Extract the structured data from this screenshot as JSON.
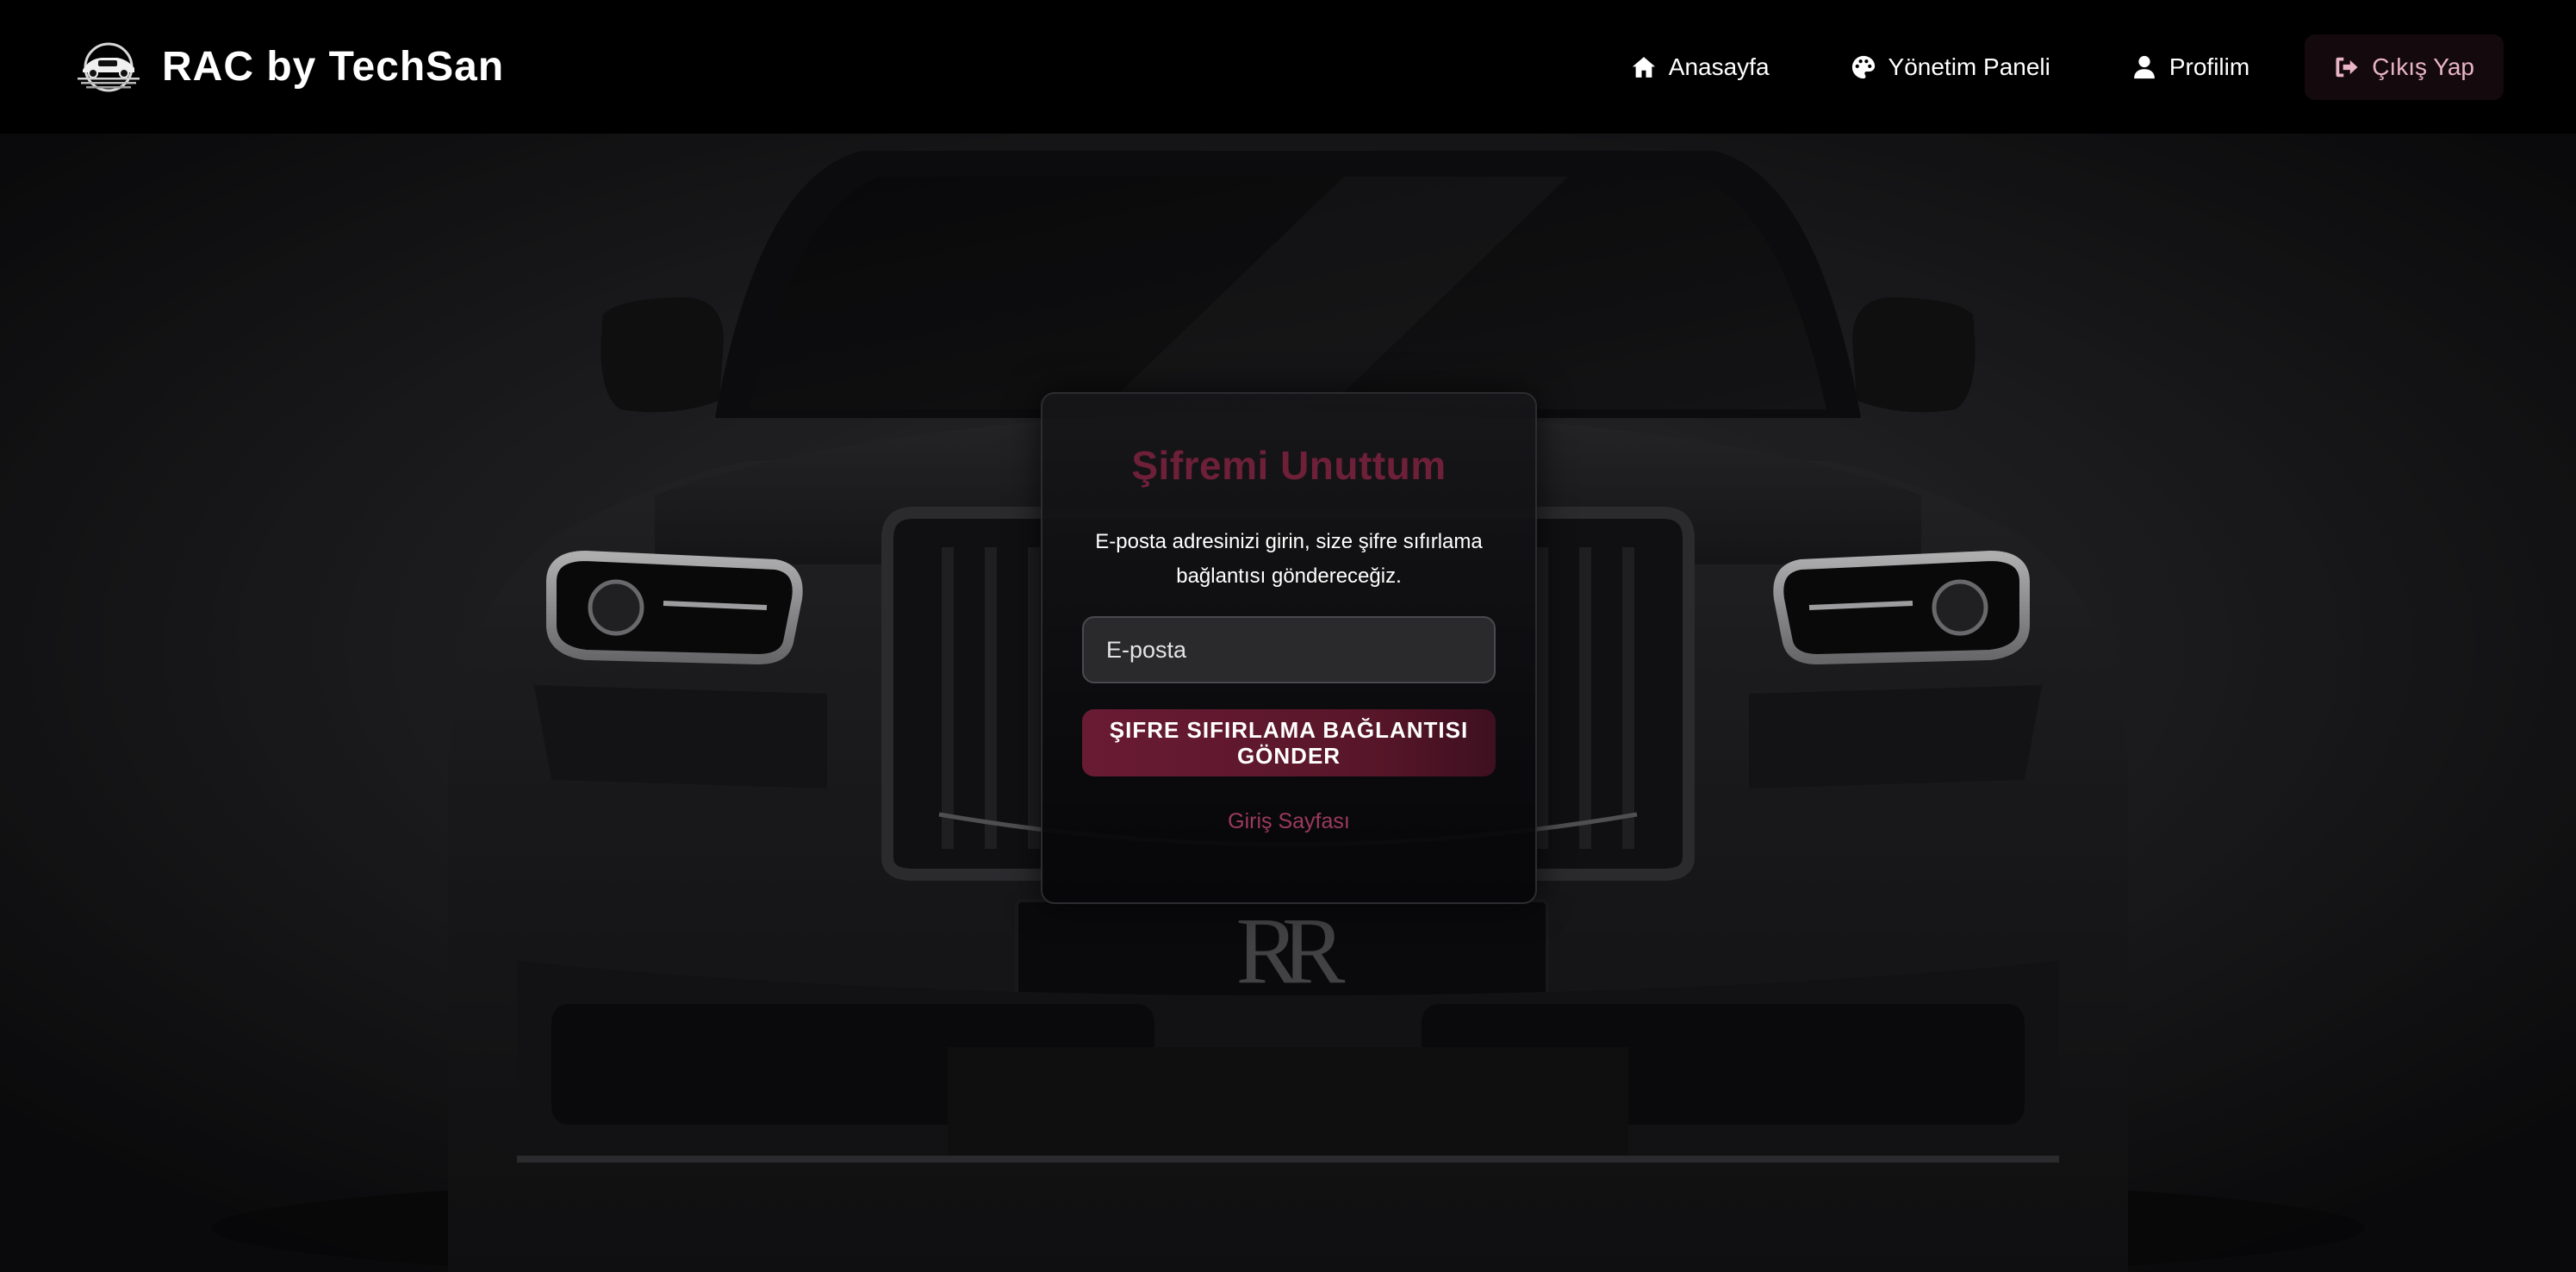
{
  "brand": {
    "name": "RAC by TechSan",
    "logo_icon": "car-logo-icon"
  },
  "nav": {
    "items": [
      {
        "label": "Anasayfa",
        "icon": "home-icon"
      },
      {
        "label": "Yönetim Paneli",
        "icon": "palette-icon"
      },
      {
        "label": "Profilim",
        "icon": "user-icon"
      },
      {
        "label": "Çıkış Yap",
        "icon": "logout-icon"
      }
    ]
  },
  "background": {
    "plate_text": "RR"
  },
  "card": {
    "title": "Şifremi Unuttum",
    "description": "E-posta adresinizi girin, size şifre sıfırlama bağlantısı göndereceğiz.",
    "email_placeholder": "E-posta",
    "submit_label": "ŞIFRE SIFIRLAMA BAĞLANTISI GÖNDER",
    "login_link": "Giriş Sayfası"
  },
  "colors": {
    "accent": "#6a1b34",
    "title": "#6d2038",
    "link": "#9c3a5c",
    "navbar": "#000000",
    "logout_bg": "#140a0e"
  }
}
